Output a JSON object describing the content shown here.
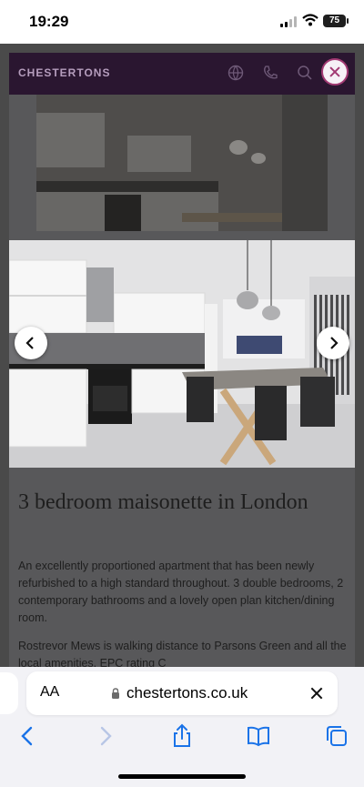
{
  "status_bar": {
    "time": "19:29",
    "battery": "75"
  },
  "site": {
    "logo": "CHESTERTONS",
    "brand_color": "#2a1630",
    "accent_color": "#a23a73",
    "header_icons": [
      "globe-icon",
      "phone-icon",
      "search-icon"
    ]
  },
  "gallery": {
    "prev_icon": "chevron-left-icon",
    "next_icon": "chevron-right-icon"
  },
  "listing": {
    "title": "3 bedroom maisonette in London",
    "description": "An excellently proportioned apartment that has been newly refurbished to a high standard throughout. 3 double bedrooms, 2 contemporary bathrooms and a lovely open plan kitchen/dining room.",
    "description_2": "Rostrevor Mews is walking distance to Parsons Green and all the local amenities. EPC rating C"
  },
  "browser": {
    "text_size_label": "AA",
    "url": "chestertons.co.uk",
    "toolbar": [
      "back-icon",
      "forward-icon",
      "share-icon",
      "bookmarks-icon",
      "tabs-icon"
    ]
  }
}
